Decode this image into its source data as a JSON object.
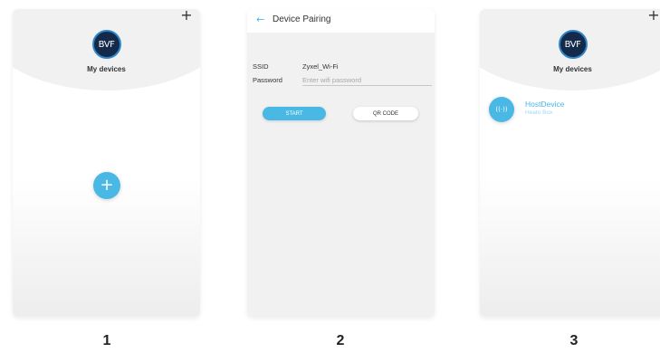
{
  "screen1": {
    "logo_text": "BVF",
    "title": "My devices",
    "add_icon_top": "plus-icon",
    "add_glyph": "+",
    "fab_glyph": "+"
  },
  "screen2": {
    "back_glyph": "←",
    "title": "Device Pairing",
    "ssid_label": "SSID",
    "ssid_value": "Zyxel_Wi-Fi",
    "password_label": "Password",
    "password_placeholder": "Enter wifi password",
    "password_value": "",
    "start_label": "START",
    "qr_label": "QR CODE"
  },
  "screen3": {
    "logo_text": "BVF",
    "title": "My devices",
    "add_glyph": "+",
    "device": {
      "icon_glyph": "((·))",
      "name": "HostDevice",
      "type": "Heato Box"
    }
  },
  "steps": [
    "1",
    "2",
    "3"
  ],
  "colors": {
    "accent": "#49b8e5",
    "logo_bg": "#132a4a",
    "text": "#333333"
  }
}
